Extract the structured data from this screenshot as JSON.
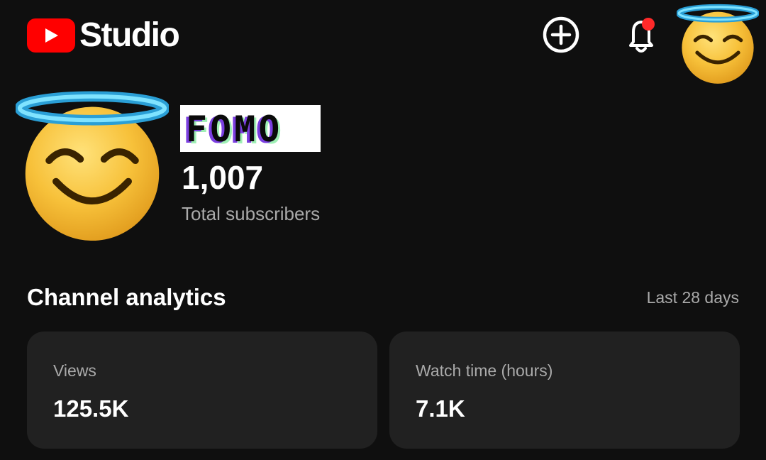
{
  "header": {
    "logo_icon": "youtube-play-icon",
    "app_name": "Studio",
    "create_icon": "plus-circle-icon",
    "notifications_icon": "bell-icon",
    "has_unread_notification": true,
    "account_avatar": "smiling-face-with-halo-emoji"
  },
  "channel": {
    "avatar": "smiling-face-with-halo-emoji",
    "name": "FOMO",
    "name_suffix": "",
    "subscriber_count": "1,007",
    "subscriber_label": "Total subscribers"
  },
  "analytics": {
    "title": "Channel analytics",
    "range": "Last 28 days",
    "cards": [
      {
        "label": "Views",
        "value": "125.5K"
      },
      {
        "label": "Watch time (hours)",
        "value": "7.1K"
      }
    ]
  },
  "colors": {
    "background": "#0f0f0f",
    "card": "#212121",
    "youtube_red": "#ff0000",
    "notification_dot": "#ff2a2a",
    "halo": "#3fc8f0",
    "muted_text": "#aaaaaa"
  }
}
